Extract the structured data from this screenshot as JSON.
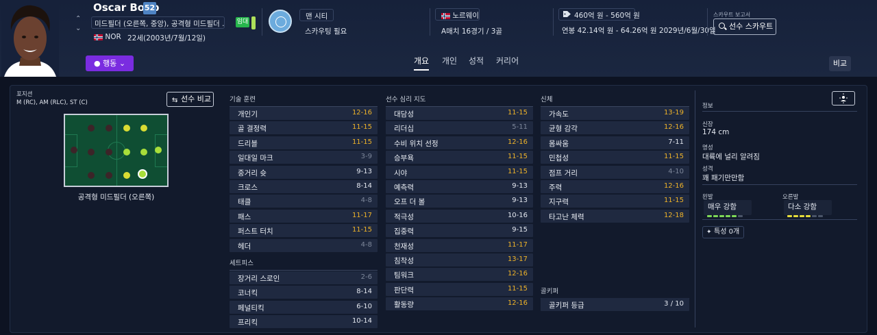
{
  "player": {
    "name": "Oscar Bobb",
    "ca": "52",
    "positions": "미드필더 (오른쪽, 중앙), 공격형 미드필더 ...",
    "nationality": "NOR",
    "age": "22세(2003년/7월/12일)",
    "loan_badge": "임대",
    "club": "맨 시티",
    "scouting_status": "스카우팅 필요",
    "nation_full": "노르웨이",
    "caps": "A매치 16경기 / 3골",
    "value": "460억 원 - 560억 원",
    "wage": "연봉 42.14억 원 - 64.26억 원 2029년/6월/30일",
    "scout_report_label": "스카우트 보고서",
    "scout_button": "선수 스카우트"
  },
  "nav": {
    "action_button": "행동",
    "tabs": [
      "개요",
      "개인",
      "성적",
      "커리어"
    ],
    "active_tab": "개요",
    "compare_button": "비교"
  },
  "position_panel": {
    "label": "포지션",
    "positions": "M (RC), AM (RLC), ST (C)",
    "compare_button": "선수 비교",
    "caption": "공격형 미드필더 (오른쪽)"
  },
  "technical": {
    "header": "기술 훈련",
    "attributes": [
      {
        "name": "개인기",
        "value": "12-16",
        "color": "#f0b429"
      },
      {
        "name": "골 결정력",
        "value": "11-15",
        "color": "#f0b429"
      },
      {
        "name": "드리블",
        "value": "11-15",
        "color": "#f0b429"
      },
      {
        "name": "일대일 마크",
        "value": "3-9",
        "color": "#7d879a"
      },
      {
        "name": "중거리 슛",
        "value": "9-13",
        "color": "#e4e8f0"
      },
      {
        "name": "크로스",
        "value": "8-14",
        "color": "#e4e8f0"
      },
      {
        "name": "태클",
        "value": "4-8",
        "color": "#7d879a"
      },
      {
        "name": "패스",
        "value": "11-17",
        "color": "#f0b429"
      },
      {
        "name": "퍼스트 터치",
        "value": "11-15",
        "color": "#f0b429"
      },
      {
        "name": "헤더",
        "value": "4-8",
        "color": "#7d879a"
      }
    ]
  },
  "setpieces": {
    "header": "세트피스",
    "attributes": [
      {
        "name": "장거리 스로인",
        "value": "2-6",
        "color": "#7d879a"
      },
      {
        "name": "코너킥",
        "value": "8-14",
        "color": "#e4e8f0"
      },
      {
        "name": "페널티킥",
        "value": "6-10",
        "color": "#e4e8f0"
      },
      {
        "name": "프리킥",
        "value": "10-14",
        "color": "#e4e8f0"
      }
    ]
  },
  "mental": {
    "header": "선수 심리 지도",
    "attributes": [
      {
        "name": "대담성",
        "value": "11-15",
        "color": "#f0b429"
      },
      {
        "name": "리더십",
        "value": "5-11",
        "color": "#7d879a"
      },
      {
        "name": "수비 위치 선정",
        "value": "12-16",
        "color": "#f0b429"
      },
      {
        "name": "승부욕",
        "value": "11-15",
        "color": "#f0b429"
      },
      {
        "name": "시야",
        "value": "11-15",
        "color": "#f0b429"
      },
      {
        "name": "예측력",
        "value": "9-13",
        "color": "#e4e8f0"
      },
      {
        "name": "오프 더 볼",
        "value": "9-13",
        "color": "#e4e8f0"
      },
      {
        "name": "적극성",
        "value": "10-16",
        "color": "#e4e8f0"
      },
      {
        "name": "집중력",
        "value": "9-15",
        "color": "#e4e8f0"
      },
      {
        "name": "천재성",
        "value": "11-17",
        "color": "#f0b429"
      },
      {
        "name": "침착성",
        "value": "13-17",
        "color": "#f0b429"
      },
      {
        "name": "팀워크",
        "value": "12-16",
        "color": "#f0b429"
      },
      {
        "name": "판단력",
        "value": "11-15",
        "color": "#f0b429"
      },
      {
        "name": "활동량",
        "value": "12-16",
        "color": "#f0b429"
      }
    ]
  },
  "physical": {
    "header": "신체",
    "attributes": [
      {
        "name": "가속도",
        "value": "13-19",
        "color": "#f0b429"
      },
      {
        "name": "균형 감각",
        "value": "12-16",
        "color": "#f0b429"
      },
      {
        "name": "몸싸움",
        "value": "7-11",
        "color": "#e4e8f0"
      },
      {
        "name": "민첩성",
        "value": "11-15",
        "color": "#f0b429"
      },
      {
        "name": "점프 거리",
        "value": "4-10",
        "color": "#7d879a"
      },
      {
        "name": "주력",
        "value": "12-16",
        "color": "#f0b429"
      },
      {
        "name": "지구력",
        "value": "11-15",
        "color": "#f0b429"
      },
      {
        "name": "타고난 체력",
        "value": "12-18",
        "color": "#f0b429"
      }
    ]
  },
  "goalkeeper": {
    "header": "골키퍼",
    "attributes": [
      {
        "name": "골키퍼 등급",
        "value": "3 / 10",
        "color": "#e4e8f0"
      }
    ]
  },
  "info": {
    "header": "정보",
    "height_label": "신장",
    "height": "174 cm",
    "reputation_label": "명성",
    "reputation": "대륙에 널리 알려짐",
    "personality_label": "성격",
    "personality": "꽤 패기만만함",
    "left_foot_label": "왼발",
    "left_foot": "매우 강함",
    "right_foot_label": "오른발",
    "right_foot": "다소 강함",
    "left_foot_level": 5,
    "right_foot_level": 4,
    "foot_max": 6,
    "traits": "특성 0개"
  },
  "colors": {
    "accent": "#7a2ce0",
    "good": "#f0b429",
    "poor": "#7d879a",
    "loan": "#27b74d",
    "pitch": "#0f4e33"
  }
}
